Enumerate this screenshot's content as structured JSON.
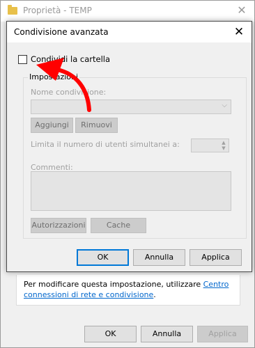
{
  "background_window": {
    "title": "Proprietà - TEMP",
    "info_text": "Per modificare questa impostazione, utilizzare ",
    "info_link": "Centro connessioni di rete e condivisione",
    "info_suffix": ".",
    "buttons": {
      "ok": "OK",
      "cancel": "Annulla",
      "apply": "Applica"
    }
  },
  "dialog": {
    "title": "Condivisione avanzata",
    "share_checkbox_label": "Condividi la cartella",
    "share_checked": false,
    "group_title": "Impostazioni",
    "share_name_label": "Nome condivisione:",
    "share_name_value": "",
    "add_button": "Aggiungi",
    "remove_button": "Rimuovi",
    "limit_label": "Limita il numero di utenti simultanei a:",
    "limit_value": "",
    "comments_label": "Commenti:",
    "comments_value": "",
    "permissions_button": "Autorizzazioni",
    "cache_button": "Cache",
    "buttons": {
      "ok": "OK",
      "cancel": "Annulla",
      "apply": "Applica"
    }
  },
  "annotation": {
    "arrow_color": "#ff0000"
  }
}
